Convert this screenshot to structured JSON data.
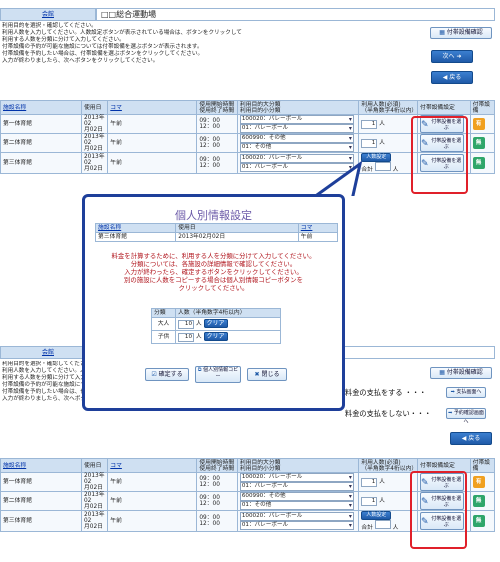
{
  "header": {
    "facility_label": "会館",
    "facility_name": "□□総合運動場"
  },
  "instructions": [
    "利用目的を選択・確認してください。",
    "利用人数を入力してください。人数設定ボタンが表示されている場合は、ボタンをクリックして",
    "利用する人数を分類に分けて入力してください。",
    "付帯設備の予約が可能な施設については付帯設備を選ぶボタンが表示されます。",
    "付帯設備を予約したい場合は、付帯設備を選ぶボタンをクリックしてください。",
    "入力が終わりましたら、次へボタンをクリックしてください。"
  ],
  "buttons": {
    "equipment_confirm": "付帯設備確認",
    "next": "次へ",
    "back": "戻る",
    "select_equipment": "付帯設備を選ぶ",
    "people_setting": "人数設定",
    "confirm": "確定する",
    "copy_personal": "個人別情報コピー",
    "close": "閉じる",
    "payment_screen": "支払画面へ",
    "reservation_confirm": "予約確認画面へ"
  },
  "table": {
    "headers": {
      "facility": "施設名称",
      "date": "使用日",
      "koma": "コマ",
      "time_start": "使用開始時間",
      "time_end": "使用終了時間",
      "purpose_major": "利用目的大分類",
      "purpose_minor": "利用目的小分類",
      "people": "利用人数(必須)",
      "people_note": "（半角数字4桁以内）",
      "equipment_setting": "付帯設備設定",
      "equipment": "付帯設備"
    },
    "rows": [
      {
        "facility": "第一体育館",
        "date1": "2013年02",
        "date2": "月02日",
        "koma": "午前",
        "start": "09：00",
        "end": "12：00",
        "major": "100020：バレーボール",
        "minor": "01：バレーボール",
        "people": "1",
        "unit": "人",
        "badge": "有",
        "badge_color": "#f0a020"
      },
      {
        "facility": "第二体育館",
        "date1": "2013年02",
        "date2": "月02日",
        "koma": "午前",
        "start": "09：00",
        "end": "12：00",
        "major": "600990：その他",
        "minor": "01：その他",
        "people": "1",
        "unit": "人",
        "badge": "無",
        "badge_color": "#2fa66a"
      },
      {
        "facility": "第三体育館",
        "date1": "2013年02",
        "date2": "月02日",
        "koma": "午前",
        "start": "09：00",
        "end": "12：00",
        "major": "100020：バレーボール",
        "minor": "01：バレーボール",
        "total_label": "合計",
        "people": "",
        "unit": "人",
        "badge": "無",
        "badge_color": "#2fa66a"
      }
    ]
  },
  "popup": {
    "title": "個人別情報設定",
    "info_headers": [
      "施設名称",
      "使用日",
      "コマ"
    ],
    "info_values": [
      "第三体育館",
      "2013年02月02日",
      "午前"
    ],
    "message": [
      "料金を計算するために、利用する人を分類に分けて入力してください。",
      "分類については、各施設の詳細情報で確認してください。",
      "入力が終わったら、確定するボタンをクリックしてください。",
      "別の施設に人数をコピーする場合は個人別情報コピーボタンを",
      "クリックしてください。"
    ],
    "cat_header": "分類",
    "num_header": "人数（半角数字4桁以内）",
    "categories": [
      {
        "name": "大人",
        "value": "10",
        "unit": "人",
        "clear": "クリア"
      },
      {
        "name": "子供",
        "value": "10",
        "unit": "人",
        "clear": "クリア"
      }
    ]
  },
  "callouts": {
    "pay": "料金の支払をする ・・・",
    "no_pay": "料金の支払をしない・・・"
  }
}
